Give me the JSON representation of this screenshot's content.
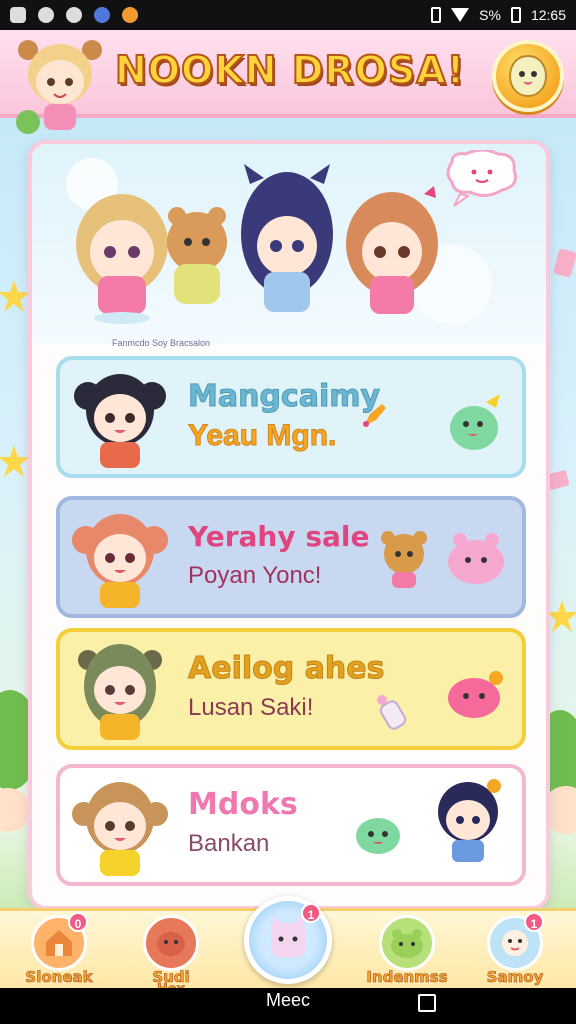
{
  "status_bar": {
    "battery": "S%",
    "time": "12:65"
  },
  "header": {
    "title": "NOOKN DROSA!"
  },
  "banner": {
    "caption": "Fanmcdo Soy Bracsalon"
  },
  "cards": [
    {
      "line1": "Mangcaimy",
      "line2": "Yeau Mgn."
    },
    {
      "line1": "Yerahy sale",
      "line2": "Poyan Yonc!"
    },
    {
      "line1": "Aeilog ahes",
      "line2": "Lusan Saki!"
    },
    {
      "line1": "Mdoks",
      "line2": "Bankan"
    }
  ],
  "bottom_nav": {
    "items": [
      {
        "label": "Sloneak",
        "badge": "0"
      },
      {
        "label": "Sudi",
        "label2": "Hex"
      },
      {
        "label": "Indenmss"
      },
      {
        "label": "Samoy",
        "badge": "1"
      }
    ],
    "center_label": "Meec",
    "center_badge": "1"
  },
  "colors": {
    "header_pink": "#fbc6dc",
    "title_yellow": "#ffd43a",
    "card1_bg": "#dff3f9",
    "card2_bg": "#c9d8f1",
    "card3_bg": "#fbf0a8",
    "card4_bg": "#ffffff"
  }
}
